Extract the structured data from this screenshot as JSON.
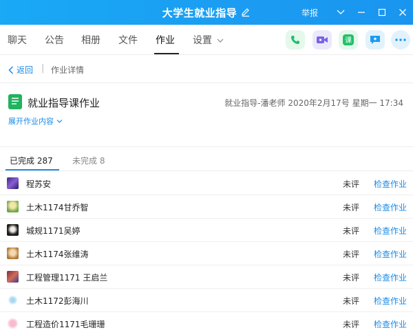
{
  "window": {
    "title": "大学生就业指导",
    "report_label": "举报"
  },
  "tabs": [
    "聊天",
    "公告",
    "相册",
    "文件",
    "作业",
    "设置"
  ],
  "active_tab": "作业",
  "toolbar_icons": [
    "phone-icon",
    "video-icon",
    "class-icon",
    "message-icon",
    "more-icon"
  ],
  "breadcrumb": {
    "back_label": "返回",
    "separator": "|",
    "current": "作业详情"
  },
  "homework": {
    "title": "就业指导课作业",
    "meta": "就业指导-潘老师 2020年2月17号 星期一 17:34",
    "expand_label": "展开作业内容"
  },
  "status_tabs": {
    "done_label": "已完成 287",
    "todo_label": "未完成 8"
  },
  "submissions": [
    {
      "name": "程苏安",
      "status": "未评",
      "action": "检查作业"
    },
    {
      "name": "土木1174甘乔智",
      "status": "未评",
      "action": "检查作业"
    },
    {
      "name": "城规1171吴婷",
      "status": "未评",
      "action": "检查作业"
    },
    {
      "name": "土木1174张维涛",
      "status": "未评",
      "action": "检查作业"
    },
    {
      "name": "工程管理1171 王启兰",
      "status": "未评",
      "action": "检查作业"
    },
    {
      "name": "土木1172彭海川",
      "status": "未评",
      "action": "检查作业"
    },
    {
      "name": "工程造价1171毛珊珊",
      "status": "未评",
      "action": "检查作业"
    }
  ],
  "colors": {
    "titlebar": "#1b9cf2",
    "accent": "#1a8be6",
    "homework_icon": "#21b35e"
  }
}
